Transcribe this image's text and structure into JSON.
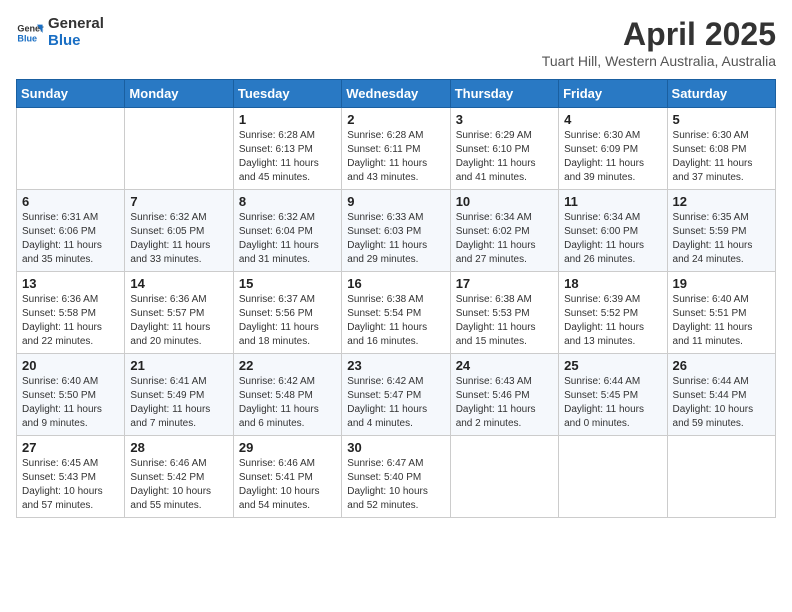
{
  "header": {
    "logo": {
      "general": "General",
      "blue": "Blue"
    },
    "title": "April 2025",
    "subtitle": "Tuart Hill, Western Australia, Australia"
  },
  "calendar": {
    "weekdays": [
      "Sunday",
      "Monday",
      "Tuesday",
      "Wednesday",
      "Thursday",
      "Friday",
      "Saturday"
    ],
    "weeks": [
      [
        {
          "day": "",
          "info": ""
        },
        {
          "day": "",
          "info": ""
        },
        {
          "day": "1",
          "info": "Sunrise: 6:28 AM\nSunset: 6:13 PM\nDaylight: 11 hours and 45 minutes."
        },
        {
          "day": "2",
          "info": "Sunrise: 6:28 AM\nSunset: 6:11 PM\nDaylight: 11 hours and 43 minutes."
        },
        {
          "day": "3",
          "info": "Sunrise: 6:29 AM\nSunset: 6:10 PM\nDaylight: 11 hours and 41 minutes."
        },
        {
          "day": "4",
          "info": "Sunrise: 6:30 AM\nSunset: 6:09 PM\nDaylight: 11 hours and 39 minutes."
        },
        {
          "day": "5",
          "info": "Sunrise: 6:30 AM\nSunset: 6:08 PM\nDaylight: 11 hours and 37 minutes."
        }
      ],
      [
        {
          "day": "6",
          "info": "Sunrise: 6:31 AM\nSunset: 6:06 PM\nDaylight: 11 hours and 35 minutes."
        },
        {
          "day": "7",
          "info": "Sunrise: 6:32 AM\nSunset: 6:05 PM\nDaylight: 11 hours and 33 minutes."
        },
        {
          "day": "8",
          "info": "Sunrise: 6:32 AM\nSunset: 6:04 PM\nDaylight: 11 hours and 31 minutes."
        },
        {
          "day": "9",
          "info": "Sunrise: 6:33 AM\nSunset: 6:03 PM\nDaylight: 11 hours and 29 minutes."
        },
        {
          "day": "10",
          "info": "Sunrise: 6:34 AM\nSunset: 6:02 PM\nDaylight: 11 hours and 27 minutes."
        },
        {
          "day": "11",
          "info": "Sunrise: 6:34 AM\nSunset: 6:00 PM\nDaylight: 11 hours and 26 minutes."
        },
        {
          "day": "12",
          "info": "Sunrise: 6:35 AM\nSunset: 5:59 PM\nDaylight: 11 hours and 24 minutes."
        }
      ],
      [
        {
          "day": "13",
          "info": "Sunrise: 6:36 AM\nSunset: 5:58 PM\nDaylight: 11 hours and 22 minutes."
        },
        {
          "day": "14",
          "info": "Sunrise: 6:36 AM\nSunset: 5:57 PM\nDaylight: 11 hours and 20 minutes."
        },
        {
          "day": "15",
          "info": "Sunrise: 6:37 AM\nSunset: 5:56 PM\nDaylight: 11 hours and 18 minutes."
        },
        {
          "day": "16",
          "info": "Sunrise: 6:38 AM\nSunset: 5:54 PM\nDaylight: 11 hours and 16 minutes."
        },
        {
          "day": "17",
          "info": "Sunrise: 6:38 AM\nSunset: 5:53 PM\nDaylight: 11 hours and 15 minutes."
        },
        {
          "day": "18",
          "info": "Sunrise: 6:39 AM\nSunset: 5:52 PM\nDaylight: 11 hours and 13 minutes."
        },
        {
          "day": "19",
          "info": "Sunrise: 6:40 AM\nSunset: 5:51 PM\nDaylight: 11 hours and 11 minutes."
        }
      ],
      [
        {
          "day": "20",
          "info": "Sunrise: 6:40 AM\nSunset: 5:50 PM\nDaylight: 11 hours and 9 minutes."
        },
        {
          "day": "21",
          "info": "Sunrise: 6:41 AM\nSunset: 5:49 PM\nDaylight: 11 hours and 7 minutes."
        },
        {
          "day": "22",
          "info": "Sunrise: 6:42 AM\nSunset: 5:48 PM\nDaylight: 11 hours and 6 minutes."
        },
        {
          "day": "23",
          "info": "Sunrise: 6:42 AM\nSunset: 5:47 PM\nDaylight: 11 hours and 4 minutes."
        },
        {
          "day": "24",
          "info": "Sunrise: 6:43 AM\nSunset: 5:46 PM\nDaylight: 11 hours and 2 minutes."
        },
        {
          "day": "25",
          "info": "Sunrise: 6:44 AM\nSunset: 5:45 PM\nDaylight: 11 hours and 0 minutes."
        },
        {
          "day": "26",
          "info": "Sunrise: 6:44 AM\nSunset: 5:44 PM\nDaylight: 10 hours and 59 minutes."
        }
      ],
      [
        {
          "day": "27",
          "info": "Sunrise: 6:45 AM\nSunset: 5:43 PM\nDaylight: 10 hours and 57 minutes."
        },
        {
          "day": "28",
          "info": "Sunrise: 6:46 AM\nSunset: 5:42 PM\nDaylight: 10 hours and 55 minutes."
        },
        {
          "day": "29",
          "info": "Sunrise: 6:46 AM\nSunset: 5:41 PM\nDaylight: 10 hours and 54 minutes."
        },
        {
          "day": "30",
          "info": "Sunrise: 6:47 AM\nSunset: 5:40 PM\nDaylight: 10 hours and 52 minutes."
        },
        {
          "day": "",
          "info": ""
        },
        {
          "day": "",
          "info": ""
        },
        {
          "day": "",
          "info": ""
        }
      ]
    ]
  }
}
